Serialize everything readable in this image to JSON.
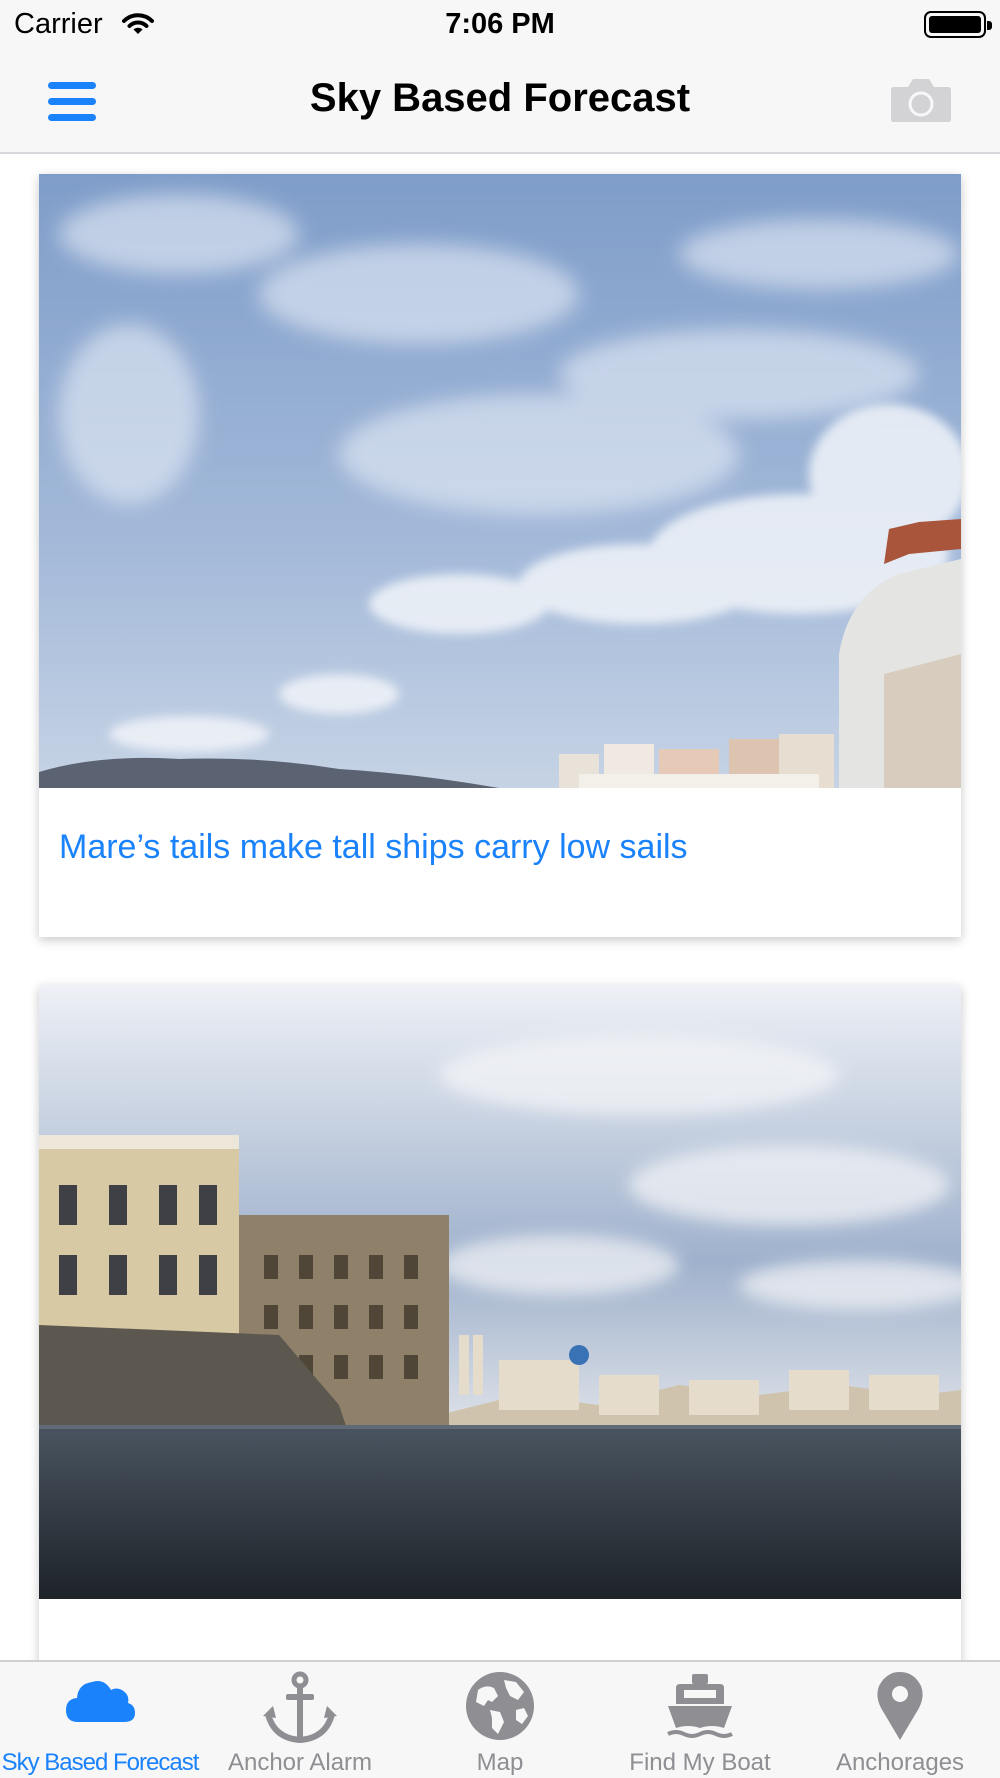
{
  "status_bar": {
    "carrier": "Carrier",
    "time": "7:06 PM"
  },
  "nav": {
    "title": "Sky Based Forecast",
    "menu_icon": "hamburger-menu-icon",
    "right_icon": "camera-icon"
  },
  "cards": [
    {
      "caption": "Mare’s tails make tall ships carry low sails",
      "image": "cirrus-sky-photo"
    },
    {
      "caption": "",
      "image": "harbor-town-photo"
    }
  ],
  "tabs": [
    {
      "label": "Sky Based Forecast",
      "icon": "cloud-icon",
      "active": true
    },
    {
      "label": "Anchor Alarm",
      "icon": "anchor-icon",
      "active": false
    },
    {
      "label": "Map",
      "icon": "globe-icon",
      "active": false
    },
    {
      "label": "Find My Boat",
      "icon": "boat-icon",
      "active": false
    },
    {
      "label": "Anchorages",
      "icon": "location-pin-icon",
      "active": false
    }
  ],
  "colors": {
    "accent": "#1a82fb",
    "inactive": "#8e8e93",
    "bar_background": "#f7f7f7"
  }
}
